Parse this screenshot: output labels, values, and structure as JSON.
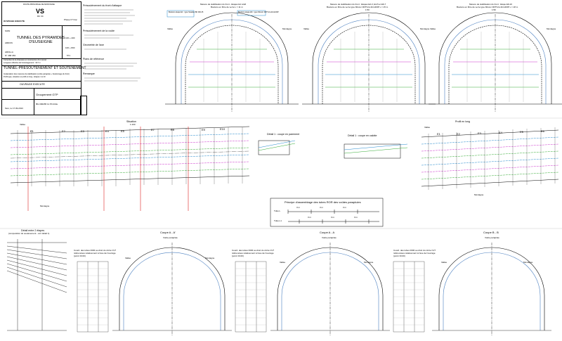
{
  "cartouche": {
    "header": "ROUTE PRINCIPALE DE MONTAGNE",
    "dept": "VS",
    "road": "RC 34",
    "etat": "OUVRAGE EXECUTE",
    "phase": "Phase N° Doc",
    "lieu_a": "SION",
    "lieu_b": "ARDON",
    "lieu_c": "AROLLA",
    "km1": "100 + 400",
    "km2": "100 + 800",
    "num": "N° 468 363",
    "code": "571",
    "title": "TUNNEL DES PYRAMIDES D'EUSEIGNE",
    "subtitle1": "Correction de la chaussée et construction d'un tunnel",
    "subtitle2": "Longueur effective de l'aménagement : 317 m",
    "main_title": "TUNNEL-PRESOUTENEMENT ET SOUTENEMENT",
    "desc1": "Implantation des mesures de stabilisation (voûte parapluie + boulonnage du front)",
    "desc2": "Profil-type, situation et profil en long - Etapes 1 à 10",
    "ouvrage": "OUVRAGE EXECUTE",
    "company": "Groupement GTP",
    "ref": "BG 000265 11 P0.410e",
    "date": "Sion, le 17.09.2013"
  },
  "notes": {
    "h1": "Présoutènement du front d'attaque",
    "h2": "Présoutènement de la voûte",
    "h3": "Géométrie de l'axe",
    "h4": "Plans de référence",
    "h5": "Remarque"
  },
  "sections": {
    "mesure1_title": "Mesure de stabilisation du front - Etapes E1 à E6",
    "mesure1_sub": "Boulons en fibre de verre L = 11 m",
    "mesure1_box1": "Boulons étape E1 : type Swellex BF RD 25",
    "mesure1_box2": "Boulons étape E6 : type Mincor FRTS-9-40-GFRP",
    "mesure2_title": "Mesure de stabilisation du front : Etapes E2-3, E4-5 et E6-7",
    "mesure2_sub": "Boulons en fibre de verre type Mincor FRTS-9-40-GFRP L = 15 m",
    "mesure3_title": "Mesure de stabilisation du front : Etape E9-10",
    "mesure3_sub": "Boulons en fibre de verre type Mincor FRTS-9-40-GFRP L = 18 m",
    "scale": "1:50",
    "vallee": "Vallée",
    "montagne": "Montagne",
    "situation": "Situation",
    "situation_scale": "1:100",
    "profil_long": "Profil en long",
    "detail1": "Détail 1 : coupe en parement",
    "detail2": "Détail 1 : coupe en calotte",
    "principe": "Principe d'assemblage des tubes ROR des voûtes parapluies",
    "tube_l": "Tube L",
    "tube_l1": "Tube L1",
    "m3": "3 m",
    "detail_etapes": "Détail entre 2 étapes",
    "detail_etapes_sub": "(composition du soutènement - voir détail 1)",
    "coupe_a": "Coupe A - A'",
    "coupe_b": "Coupe A - A",
    "coupe_c": "Coupe B - B",
    "voute": "Voûte parapluie",
    "coord": "Coord. des tubes ROR au droit du cintre CV7",
    "coord_sub": "référencées relativement à l'axe de l'ouvrage",
    "point": "(point ±0.00)"
  },
  "etapes": [
    "E1",
    "E2",
    "E3",
    "E4",
    "E5",
    "E6",
    "E7",
    "E8",
    "E9",
    "E10"
  ]
}
